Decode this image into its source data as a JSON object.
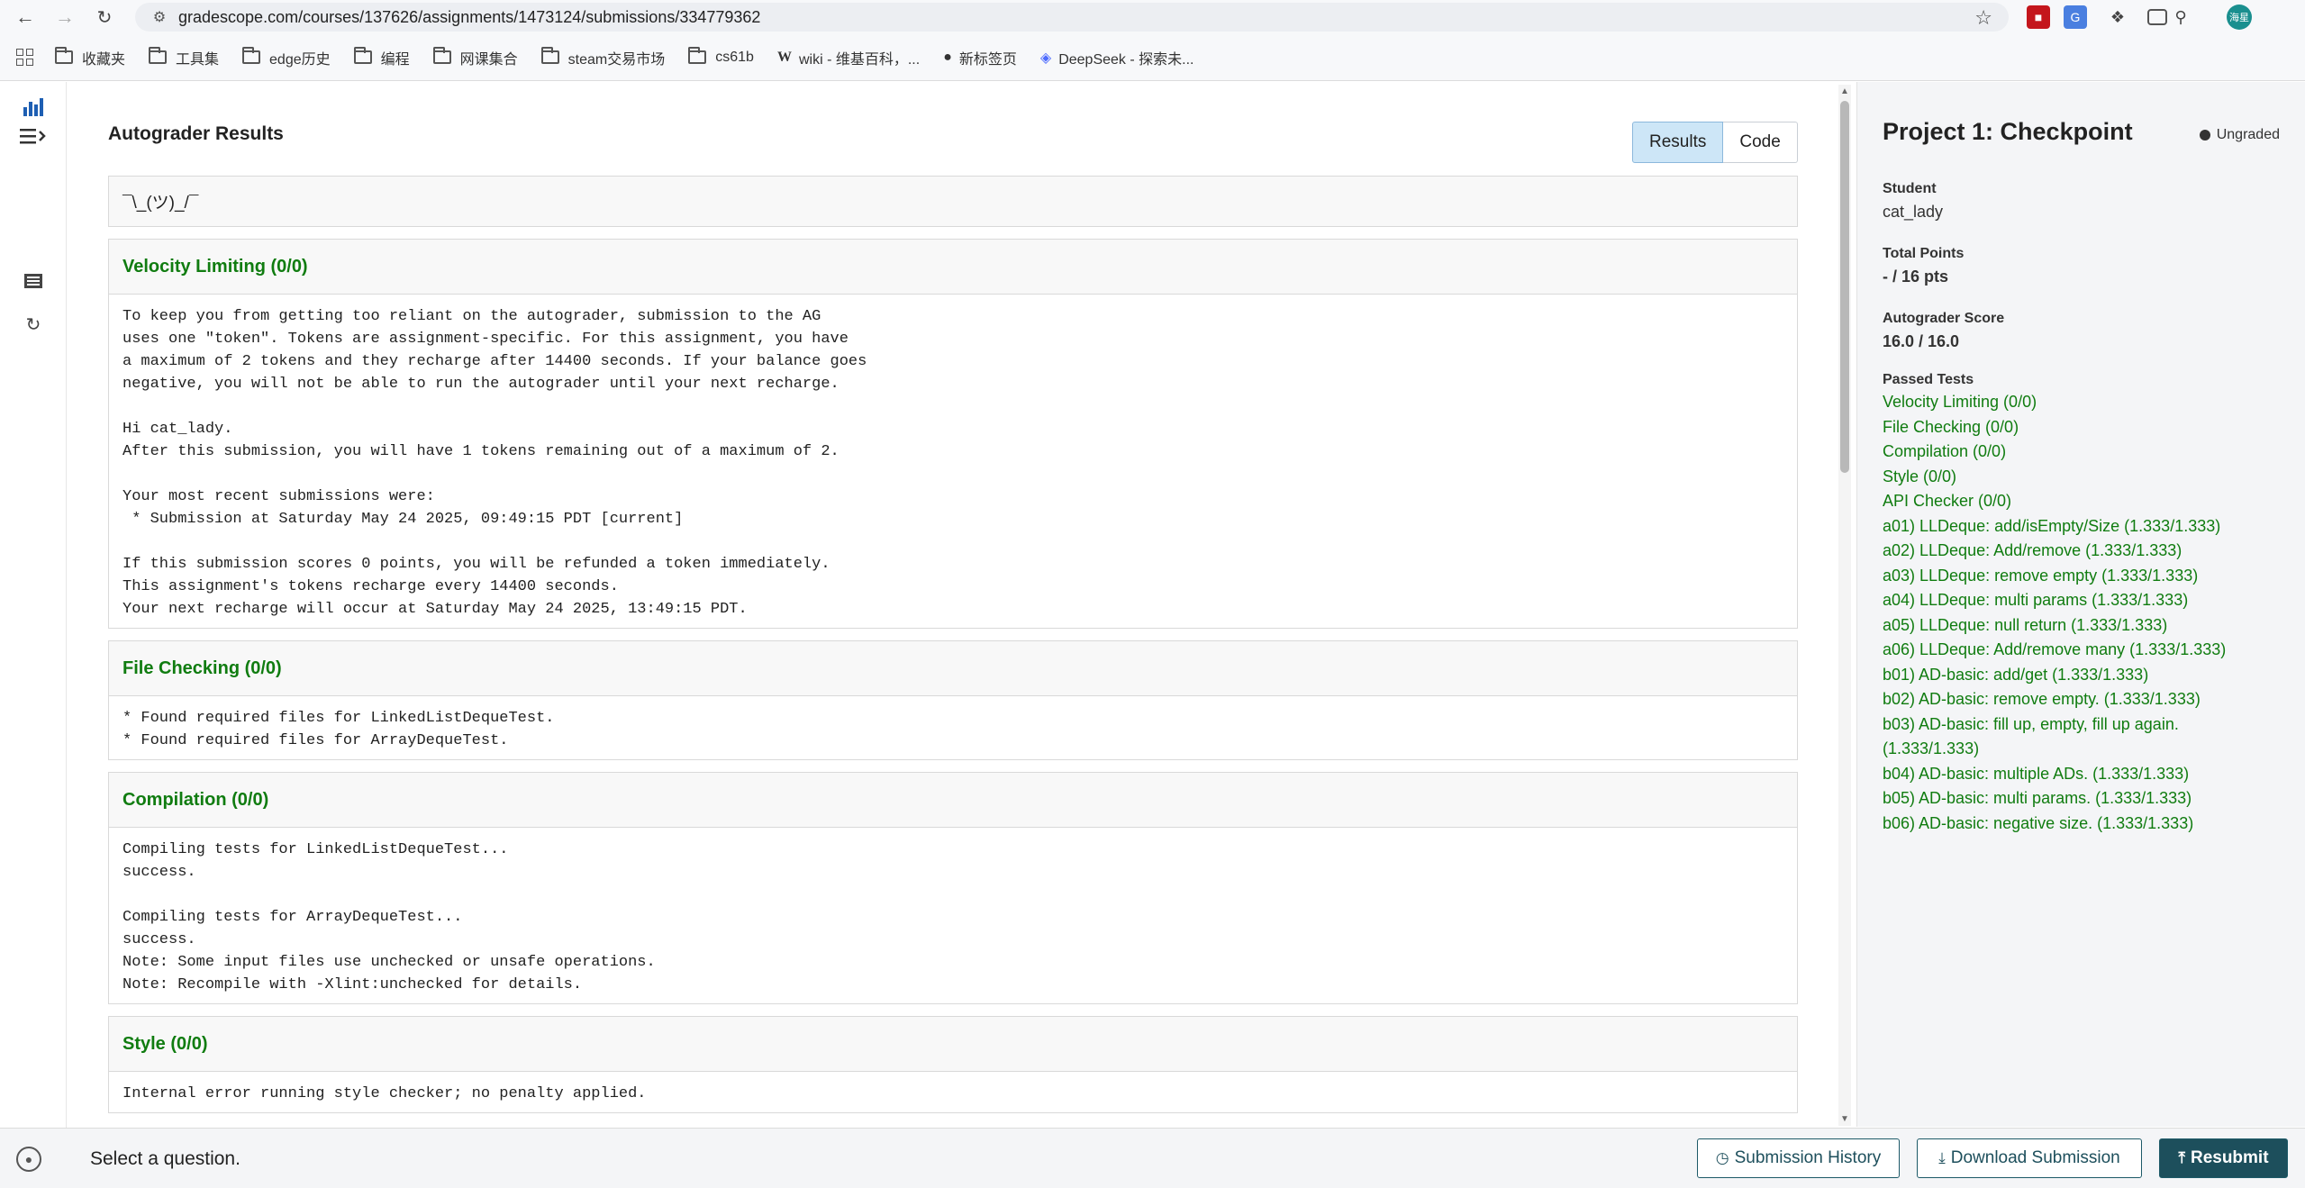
{
  "browser": {
    "url": "gradescope.com/courses/137626/assignments/1473124/submissions/334779362",
    "bookmarks": [
      "收藏夹",
      "工具集",
      "edge历史",
      "编程",
      "网课集合",
      "steam交易市场",
      "cs61b",
      "wiki - 维基百科，...",
      "新标签页",
      "DeepSeek - 探索未..."
    ],
    "profile_label": "海星"
  },
  "main": {
    "title": "Autograder Results",
    "tabs": [
      "Results",
      "Code"
    ],
    "shrug": "¯\\_(ツ)_/¯",
    "sections": [
      {
        "title": "Velocity Limiting (0/0)",
        "body": "To keep you from getting too reliant on the autograder, submission to the AG\nuses one \"token\". Tokens are assignment-specific. For this assignment, you have\na maximum of 2 tokens and they recharge after 14400 seconds. If your balance goes\nnegative, you will not be able to run the autograder until your next recharge.\n\nHi cat_lady.\nAfter this submission, you will have 1 tokens remaining out of a maximum of 2.\n\nYour most recent submissions were:\n * Submission at Saturday May 24 2025, 09:49:15 PDT [current]\n\nIf this submission scores 0 points, you will be refunded a token immediately.\nThis assignment's tokens recharge every 14400 seconds.\nYour next recharge will occur at Saturday May 24 2025, 13:49:15 PDT."
      },
      {
        "title": "File Checking (0/0)",
        "body": "* Found required files for LinkedListDequeTest.\n* Found required files for ArrayDequeTest."
      },
      {
        "title": "Compilation (0/0)",
        "body": "Compiling tests for LinkedListDequeTest...\nsuccess.\n\nCompiling tests for ArrayDequeTest...\nsuccess.\nNote: Some input files use unchecked or unsafe operations.\nNote: Recompile with -Xlint:unchecked for details."
      },
      {
        "title": "Style (0/0)",
        "body": "Internal error running style checker; no penalty applied."
      }
    ]
  },
  "panel": {
    "title": "Project 1: Checkpoint",
    "status": "Ungraded",
    "student_label": "Student",
    "student": "cat_lady",
    "total_label": "Total Points",
    "total": "- / 16 pts",
    "ag_label": "Autograder Score",
    "ag_score": "16.0 / 16.0",
    "passed_label": "Passed Tests",
    "passed_tests": [
      "Velocity Limiting (0/0)",
      "File Checking (0/0)",
      "Compilation (0/0)",
      "Style (0/0)",
      "API Checker (0/0)",
      "a01) LLDeque: add/isEmpty/Size (1.333/1.333)",
      "a02) LLDeque: Add/remove (1.333/1.333)",
      "a03) LLDeque: remove empty (1.333/1.333)",
      "a04) LLDeque: multi params (1.333/1.333)",
      "a05) LLDeque: null return (1.333/1.333)",
      "a06) LLDeque: Add/remove many (1.333/1.333)",
      "b01) AD-basic: add/get (1.333/1.333)",
      "b02) AD-basic: remove empty. (1.333/1.333)",
      "b03) AD-basic: fill up, empty, fill up again. (1.333/1.333)",
      "b04) AD-basic: multiple ADs. (1.333/1.333)",
      "b05) AD-basic: multi params. (1.333/1.333)",
      "b06) AD-basic: negative size. (1.333/1.333)"
    ]
  },
  "footer": {
    "select_question": "Select a question.",
    "history": "Submission History",
    "download": "Download Submission",
    "resubmit": "Resubmit"
  },
  "colors": {
    "pass_green": "#107c10",
    "primary": "#1d4f5c",
    "tab_active": "#cde6f7"
  }
}
